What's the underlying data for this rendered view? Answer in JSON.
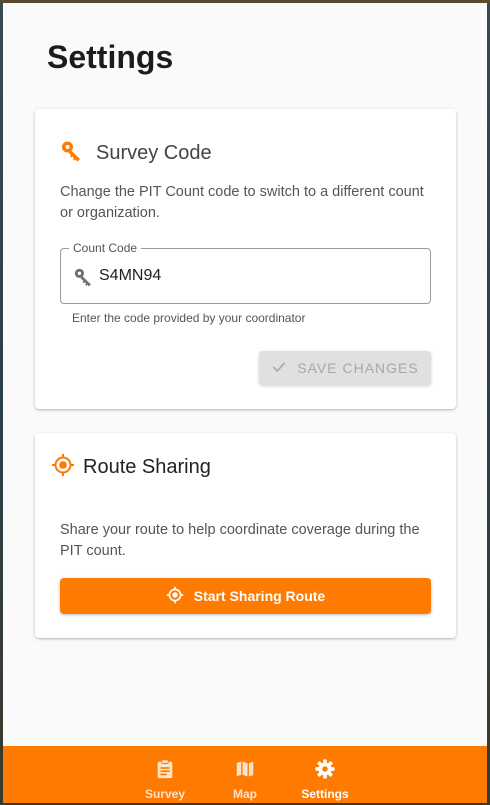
{
  "page": {
    "title": "Settings"
  },
  "survey_code_card": {
    "title": "Survey Code",
    "title_icon": "key-icon",
    "description": "Change the PIT Count code to switch to a different count or organization.",
    "field": {
      "label": "Count Code",
      "value": "S4MN94",
      "icon": "key-icon",
      "helper": "Enter the code provided by your coordinator"
    },
    "save_button": {
      "label": "SAVE CHANGES",
      "icon": "check-icon",
      "disabled": true
    }
  },
  "route_sharing_card": {
    "title": "Route Sharing",
    "title_icon": "location-target-icon",
    "description": "Share your route to help coordinate coverage during the PIT count.",
    "share_button": {
      "label": "Start Sharing Route",
      "icon": "location-target-icon"
    }
  },
  "bottom_nav": {
    "items": [
      {
        "label": "Survey",
        "icon": "clipboard-icon"
      },
      {
        "label": "Map",
        "icon": "map-icon"
      },
      {
        "label": "Settings",
        "icon": "gear-icon",
        "active": true
      }
    ]
  },
  "colors": {
    "accent": "#ff7a00",
    "disabled_button": "#e0e0e0",
    "background": "#fafafa"
  }
}
